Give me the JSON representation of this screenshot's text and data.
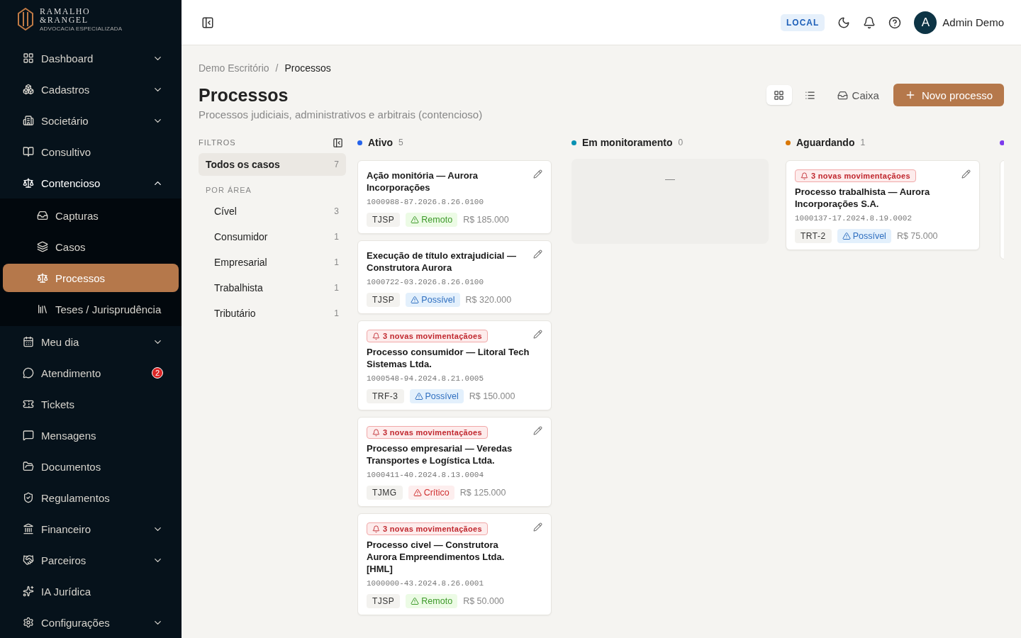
{
  "logo": {
    "line_1": "RAMALHO",
    "line_2": "&RANGEL",
    "tagline": "ADVOCACIA ESPECIALIZADA"
  },
  "sidebar": {
    "items": [
      {
        "label": "Dashboard",
        "expanded": false,
        "selected": false
      },
      {
        "label": "Cadastros",
        "expanded": false,
        "selected": false
      },
      {
        "label": "Societário",
        "expanded": false,
        "selected": false
      },
      {
        "label": "Consultivo",
        "selected": false
      },
      {
        "label": "Contencioso",
        "expanded": true,
        "selected": false,
        "children": [
          {
            "label": "Capturas",
            "selected": false
          },
          {
            "label": "Casos",
            "selected": false
          },
          {
            "label": "Processos",
            "selected": true
          },
          {
            "label": "Teses / Jurisprudência",
            "selected": false
          }
        ]
      },
      {
        "label": "Meu dia",
        "expanded": false,
        "selected": false
      },
      {
        "label": "Atendimento",
        "badge": "2",
        "selected": false
      },
      {
        "label": "Tickets",
        "selected": false
      },
      {
        "label": "Mensagens",
        "selected": false
      },
      {
        "label": "Documentos",
        "selected": false
      },
      {
        "label": "Regulamentos",
        "selected": false
      },
      {
        "label": "Financeiro",
        "expanded": false,
        "selected": false
      },
      {
        "label": "Parceiros",
        "expanded": false,
        "selected": false
      },
      {
        "label": "IA Jurídica",
        "selected": false
      },
      {
        "label": "Configurações",
        "expanded": false,
        "selected": false
      }
    ]
  },
  "header": {
    "environment": "LOCAL",
    "avatar": "A",
    "user": "Admin Demo"
  },
  "breadcrumb": {
    "separator": "/",
    "items": [
      "Demo Escritório",
      "Processos"
    ]
  },
  "page": {
    "title": "Processos",
    "subtitle": "Processos judiciais, administrativos e arbitrais (contencioso)"
  },
  "toolbar": {
    "views": [
      {
        "kind": "grid",
        "selected": true
      },
      {
        "kind": "list",
        "selected": false
      }
    ],
    "inbox_button": "Caixa",
    "primary_button": "Novo processo"
  },
  "filters": {
    "title": "FILTROS",
    "all": {
      "label": "Todos os casos",
      "count": "7",
      "selected": true
    },
    "section": "POR ÁREA",
    "items": [
      {
        "label": "Cível",
        "count": "3",
        "selected": false
      },
      {
        "label": "Consumidor",
        "count": "1",
        "selected": false
      },
      {
        "label": "Empresarial",
        "count": "1",
        "selected": false
      },
      {
        "label": "Trabalhista",
        "count": "1",
        "selected": false
      },
      {
        "label": "Tributário",
        "count": "1",
        "selected": false
      }
    ]
  },
  "board": {
    "columns": [
      {
        "title": "Ativo",
        "count": "5",
        "color": "#2563eb",
        "cards": [
          {
            "title": "Ação monitória — Aurora Incorporações",
            "number": "1000988-87.2026.8.26.0100",
            "court": "TJSP",
            "risk": {
              "kind": "remote",
              "label": "Remoto"
            },
            "value": "R$ 185.000"
          },
          {
            "title": "Execução de título extrajudicial — Construtora Aurora",
            "number": "1000722-03.2026.8.26.0100",
            "court": "TJSP",
            "risk": {
              "kind": "possible",
              "label": "Possível"
            },
            "value": "R$ 320.000"
          },
          {
            "alert": "3 novas movimentaçãoes",
            "title": "Processo consumidor — Litoral Tech Sistemas Ltda.",
            "number": "1000548-94.2024.8.21.0005",
            "court": "TRF-3",
            "risk": {
              "kind": "possible",
              "label": "Possível"
            },
            "value": "R$ 150.000"
          },
          {
            "alert": "3 novas movimentaçãoes",
            "title": "Processo empresarial — Veredas Transportes e Logística Ltda.",
            "number": "1000411-40.2024.8.13.0004",
            "court": "TJMG",
            "risk": {
              "kind": "critical",
              "label": "Crítico"
            },
            "value": "R$ 125.000"
          },
          {
            "alert": "3 novas movimentaçãoes",
            "title": "Processo civel — Construtora Aurora Empreendimentos Ltda. [HML]",
            "number": "1000000-43.2024.8.26.0001",
            "court": "TJSP",
            "risk": {
              "kind": "remote",
              "label": "Remoto"
            },
            "value": "R$ 50.000"
          }
        ]
      },
      {
        "title": "Em monitoramento",
        "count": "0",
        "color": "#0891b2",
        "empty_text": "—"
      },
      {
        "title": "Aguardando",
        "count": "1",
        "color": "#d97706",
        "cards": [
          {
            "alert": "3 novas movimentaçãoes",
            "title": "Processo trabalhista — Aurora Incorporações S.A.",
            "number": "1000137-17.2024.8.19.0002",
            "court": "TRT-2",
            "risk": {
              "kind": "possible",
              "label": "Possível"
            },
            "value": "R$ 75.000"
          }
        ]
      },
      {
        "color": "#7c3aed"
      }
    ]
  }
}
